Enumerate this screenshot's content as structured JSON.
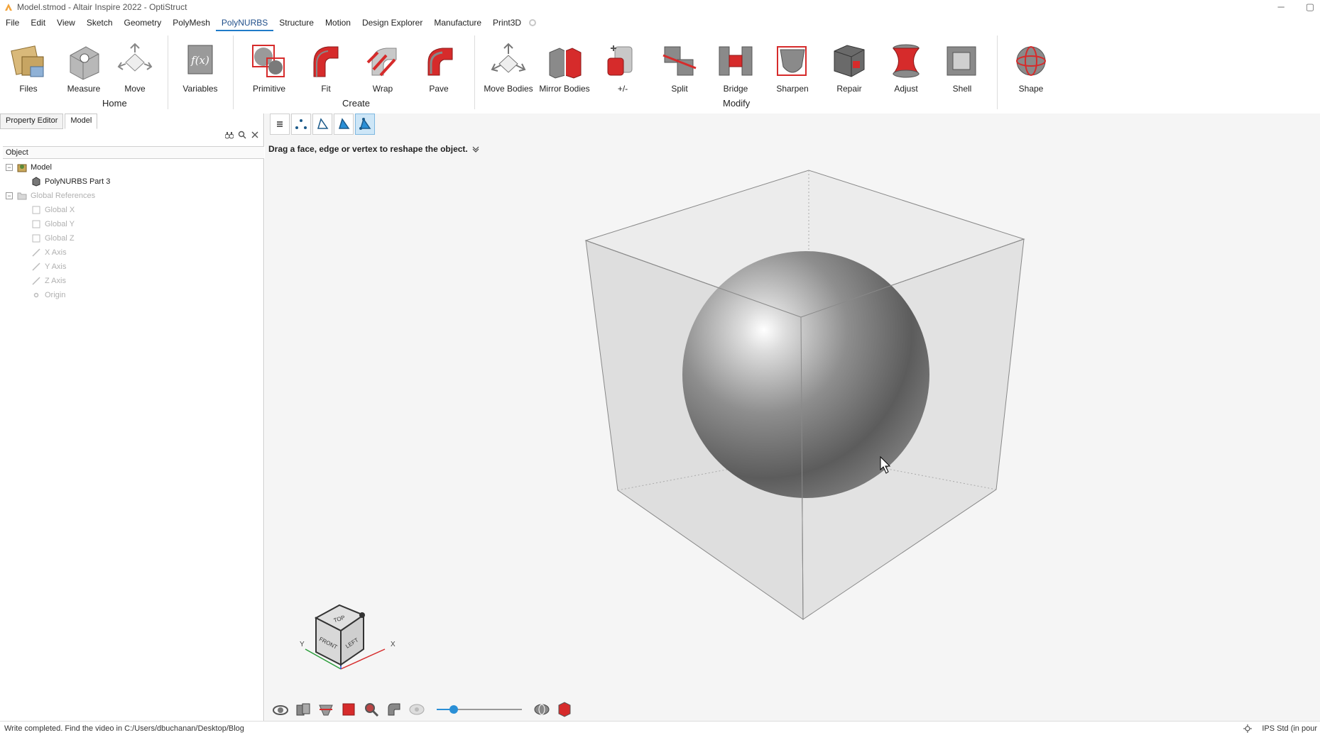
{
  "window": {
    "title": "Model.stmod - Altair Inspire 2022 - OptiStruct",
    "minimize": "─",
    "maximize": "▢"
  },
  "menu": {
    "items": [
      "File",
      "Edit",
      "View",
      "Sketch",
      "Geometry",
      "PolyMesh",
      "PolyNURBS",
      "Structure",
      "Motion",
      "Design Explorer",
      "Manufacture",
      "Print3D"
    ],
    "active": "PolyNURBS"
  },
  "ribbon": {
    "home": {
      "group_label": "Home",
      "files": "Files",
      "measure": "Measure",
      "move": "Move"
    },
    "variables": "Variables",
    "create": {
      "group_label": "Create",
      "primitive": "Primitive",
      "fit": "Fit",
      "wrap": "Wrap",
      "pave": "Pave"
    },
    "modify": {
      "group_label": "Modify",
      "move_bodies": "Move Bodies",
      "mirror_bodies": "Mirror Bodies",
      "plus_minus": "+/-",
      "split": "Split",
      "bridge": "Bridge",
      "sharpen": "Sharpen",
      "repair": "Repair",
      "adjust": "Adjust",
      "shell": "Shell"
    },
    "shape": "Shape"
  },
  "panel": {
    "tabs": [
      "Property Editor",
      "Model"
    ],
    "active_tab": "Model",
    "column_header": "Object",
    "tree": {
      "model": "Model",
      "part": "PolyNURBS Part 3",
      "global_references": "Global References",
      "global_x": "Global X",
      "global_y": "Global Y",
      "global_z": "Global Z",
      "x_axis": "X Axis",
      "y_axis": "Y Axis",
      "z_axis": "Z Axis",
      "origin": "Origin"
    }
  },
  "viewport": {
    "hint": "Drag a face, edge or vertex to reshape the object.",
    "viewcube": {
      "top": "TOP",
      "front": "FRONT",
      "left": "LEFT",
      "axis_x": "X",
      "axis_y": "Y"
    },
    "slider_value": 0.2
  },
  "status": {
    "message": "Write completed. Find the video in C:/Users/dbuchanan/Desktop/Blog",
    "units": "IPS Std (in pour"
  },
  "colors": {
    "accent": "#1f7bc9",
    "red_tool": "#d62b2b",
    "viewport_bg": "#f5f5f5"
  }
}
